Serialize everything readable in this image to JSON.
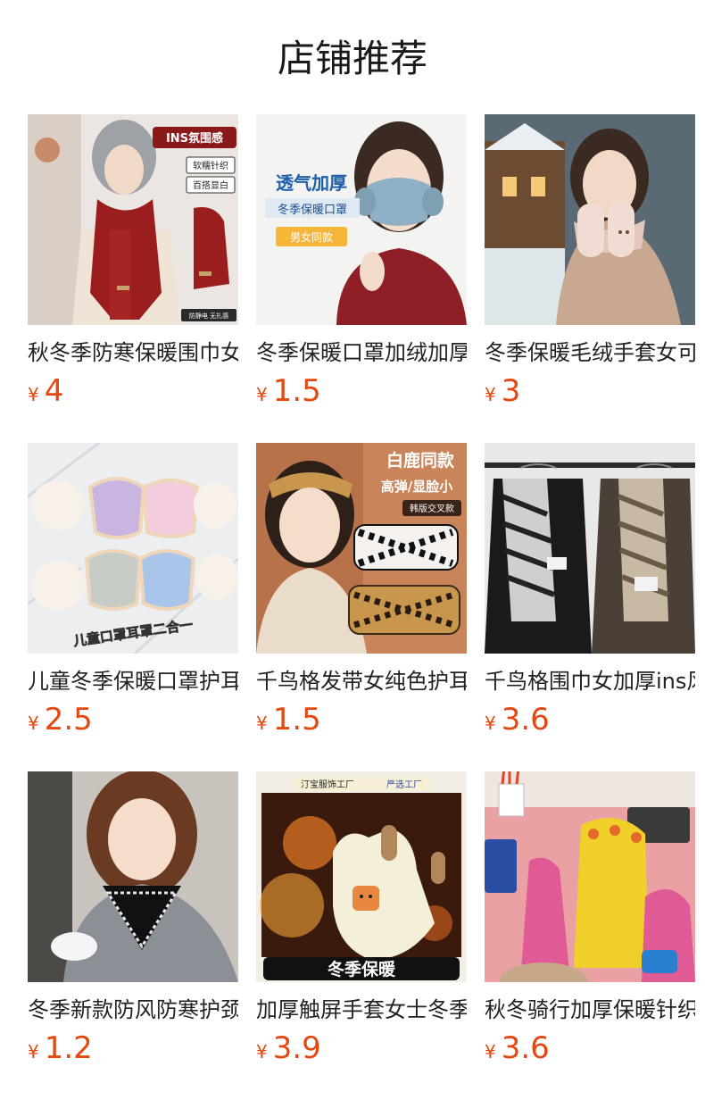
{
  "page_title": "店铺推荐",
  "currency": "¥",
  "products": [
    {
      "name": "秋冬季防寒保暖围巾女",
      "price": "4",
      "image": {
        "kind": "scarf-red",
        "labels": [
          "INS氛围感",
          "软糯针织",
          "百搭显白",
          "防静电 无扎感"
        ]
      }
    },
    {
      "name": "冬季保暖口罩加绒加厚",
      "price": "1.5",
      "image": {
        "kind": "mask-blue",
        "labels": [
          "透气加厚",
          "冬季保暖口罩",
          "男女同款"
        ]
      }
    },
    {
      "name": "冬季保暖毛绒手套女可爱",
      "price": "3",
      "image": {
        "kind": "gloves-snow",
        "labels": []
      }
    },
    {
      "name": "儿童冬季保暖口罩护耳罩",
      "price": "2.5",
      "image": {
        "kind": "kids-masks",
        "labels": [
          "儿童口罩耳罩二合一"
        ]
      }
    },
    {
      "name": "千鸟格发带女纯色护耳",
      "price": "1.5",
      "image": {
        "kind": "headband",
        "labels": [
          "白鹿同款",
          "高弹/显脸小",
          "韩版交叉款"
        ]
      }
    },
    {
      "name": "千鸟格围巾女加厚ins风",
      "price": "3.6",
      "image": {
        "kind": "houndstooth-scarves",
        "labels": []
      }
    },
    {
      "name": "冬季新款防风防寒护颈",
      "price": "1.2",
      "image": {
        "kind": "neck-scarf",
        "labels": []
      }
    },
    {
      "name": "加厚触屏手套女士冬季",
      "price": "3.9",
      "image": {
        "kind": "touch-gloves",
        "labels": [
          "汀宝服饰工厂",
          "严选工厂",
          "冬季保暖"
        ]
      }
    },
    {
      "name": "秋冬骑行加厚保暖针织",
      "price": "3.6",
      "image": {
        "kind": "kids-gloves",
        "labels": []
      }
    }
  ]
}
